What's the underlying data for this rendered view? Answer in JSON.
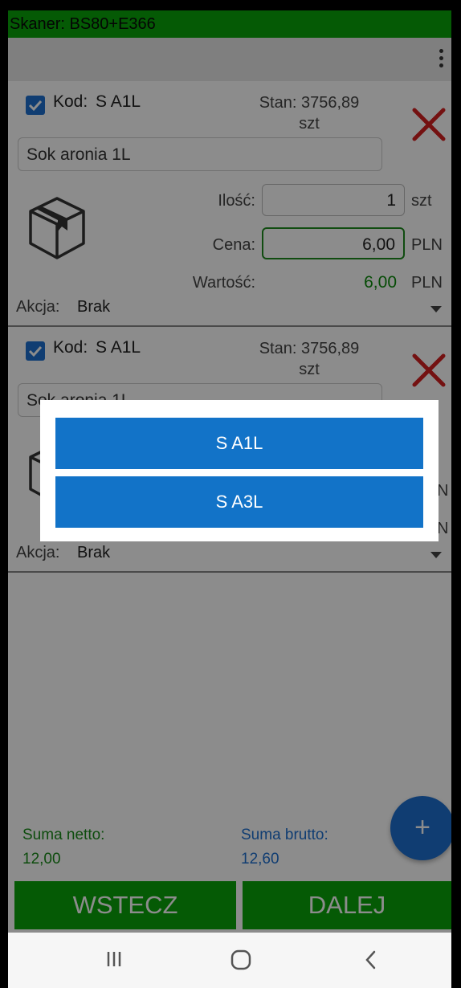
{
  "status_bar": {
    "title": "Skaner: BS80+E366"
  },
  "colors": {
    "accent_green": "#0aa40a",
    "accent_blue": "#1273c8",
    "delete_red": "#d32020"
  },
  "items": [
    {
      "checked": true,
      "code_label": "Kod:",
      "code": "S A1L",
      "stan_label": "Stan:",
      "stan_value": "3756,89",
      "stan_unit": "szt",
      "name": "Sok aronia 1L",
      "qty_label": "Ilość:",
      "qty": "1",
      "qty_unit": "szt",
      "price_label": "Cena:",
      "price": "6,00",
      "price_currency": "PLN",
      "value_label": "Wartość:",
      "value": "6,00",
      "value_currency": "PLN",
      "action_label": "Akcja:",
      "action_value": "Brak"
    },
    {
      "checked": true,
      "code_label": "Kod:",
      "code": "S A1L",
      "stan_label": "Stan:",
      "stan_value": "3756,89",
      "stan_unit": "szt",
      "name": "Sok aronia 1L",
      "action_label": "Akcja:",
      "action_value": "Brak",
      "partial_units": [
        "N",
        "N"
      ]
    }
  ],
  "totals": {
    "netto_label": "Suma netto:",
    "netto_value": "12,00",
    "brutto_label": "Suma brutto:",
    "brutto_value": "12,60"
  },
  "fab": {
    "icon": "plus-icon",
    "label": "+"
  },
  "buttons": {
    "back": "WSTECZ",
    "next": "DALEJ"
  },
  "system_nav": {
    "icons": [
      "recent-apps-icon",
      "home-icon",
      "back-icon"
    ]
  },
  "dialog": {
    "options": [
      "S A1L",
      "S A3L"
    ]
  }
}
